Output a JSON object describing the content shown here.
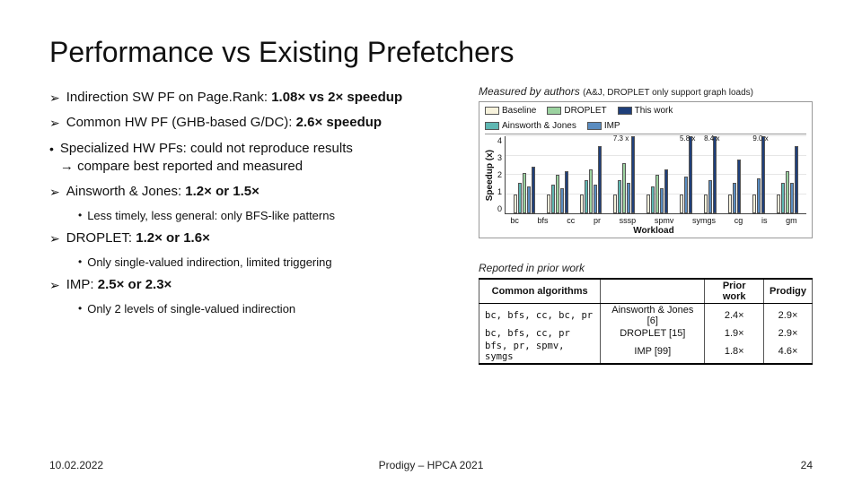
{
  "title": "Performance vs Existing Prefetchers",
  "bullets": {
    "b1_pre": "Indirection SW PF on Page.Rank: ",
    "b1_bold": "1.08× vs 2× speedup",
    "b2_pre": "Common HW PF (GHB-based G/DC): ",
    "b2_bold": "2.6× speedup",
    "b3_line1": "Specialized HW PFs: could not reproduce results",
    "b3_line2": "→ compare best reported and measured",
    "b4_pre": "Ainsworth & Jones: ",
    "b4_bold": "1.2× or 1.5×",
    "b4_sub": "Less timely, less general: only BFS-like patterns",
    "b5_pre": "DROPLET: ",
    "b5_bold": "1.2× or 1.6×",
    "b5_sub": "Only single-valued indirection, limited triggering",
    "b6_pre": "IMP: ",
    "b6_bold": "2.5× or 2.3×",
    "b6_sub": "Only 2 levels of single-valued indirection"
  },
  "caption_top_a": "Measured by authors ",
  "caption_top_b": "(A&J, DROPLET only support graph loads)",
  "caption_bottom": "Reported in prior work",
  "footer": {
    "left": "10.02.2022",
    "center": "Prodigy – HPCA 2021",
    "right": "24"
  },
  "legend": {
    "baseline": "Baseline",
    "aj": "Ainsworth & Jones",
    "droplet": "DROPLET",
    "imp": "IMP",
    "thiswork": "This work"
  },
  "colors": {
    "baseline": "#f7f2dc",
    "aj": "#5fb7b2",
    "droplet": "#9cd2a0",
    "imp": "#5a8cc0",
    "thiswork": "#1f3f7a"
  },
  "axes": {
    "ylabel": "Speedup (x)",
    "xlabel": "Workload",
    "yticks": [
      "4",
      "3",
      "2",
      "1",
      "0"
    ]
  },
  "table": {
    "headers": [
      "Common algorithms",
      "",
      "Prior work",
      "Prodigy"
    ],
    "rows": [
      {
        "algos": "bc, bfs, cc, bc, pr",
        "name": "Ainsworth & Jones [6]",
        "prior": "2.4×",
        "prodigy": "2.9×"
      },
      {
        "algos": "bc, bfs, cc, pr",
        "name": "DROPLET [15]",
        "prior": "1.9×",
        "prodigy": "2.9×"
      },
      {
        "algos": "bfs, pr, spmv, symgs",
        "name": "IMP [99]",
        "prior": "1.8×",
        "prodigy": "4.6×"
      }
    ]
  },
  "chart_data": {
    "type": "bar",
    "title": "",
    "xlabel": "Workload",
    "ylabel": "Speedup (x)",
    "ylim": [
      0,
      4
    ],
    "categories": [
      "bc",
      "bfs",
      "cc",
      "pr",
      "sssp",
      "spmv",
      "symgs",
      "cg",
      "is",
      "gm"
    ],
    "series": [
      {
        "name": "Baseline",
        "values": [
          1.0,
          1.0,
          1.0,
          1.0,
          1.0,
          1.0,
          1.0,
          1.0,
          1.0,
          1.0
        ]
      },
      {
        "name": "Ainsworth & Jones",
        "values": [
          1.6,
          1.5,
          1.7,
          1.7,
          1.4,
          null,
          null,
          null,
          null,
          1.6
        ]
      },
      {
        "name": "DROPLET",
        "values": [
          2.1,
          2.0,
          2.3,
          2.6,
          2.0,
          null,
          null,
          null,
          null,
          2.2
        ]
      },
      {
        "name": "IMP",
        "values": [
          1.4,
          1.3,
          1.5,
          1.6,
          1.3,
          1.9,
          1.7,
          1.6,
          1.8,
          1.6
        ]
      },
      {
        "name": "This work",
        "values": [
          2.4,
          2.2,
          3.5,
          7.3,
          2.3,
          5.8,
          8.4,
          2.8,
          9.0,
          3.5
        ]
      }
    ],
    "annotations": [
      {
        "category": "pr",
        "text": "7.3 x"
      },
      {
        "category": "spmv",
        "text": "5.8 x"
      },
      {
        "category": "symgs",
        "text": "8.4 x"
      },
      {
        "category": "is",
        "text": "9.0 x"
      }
    ]
  }
}
